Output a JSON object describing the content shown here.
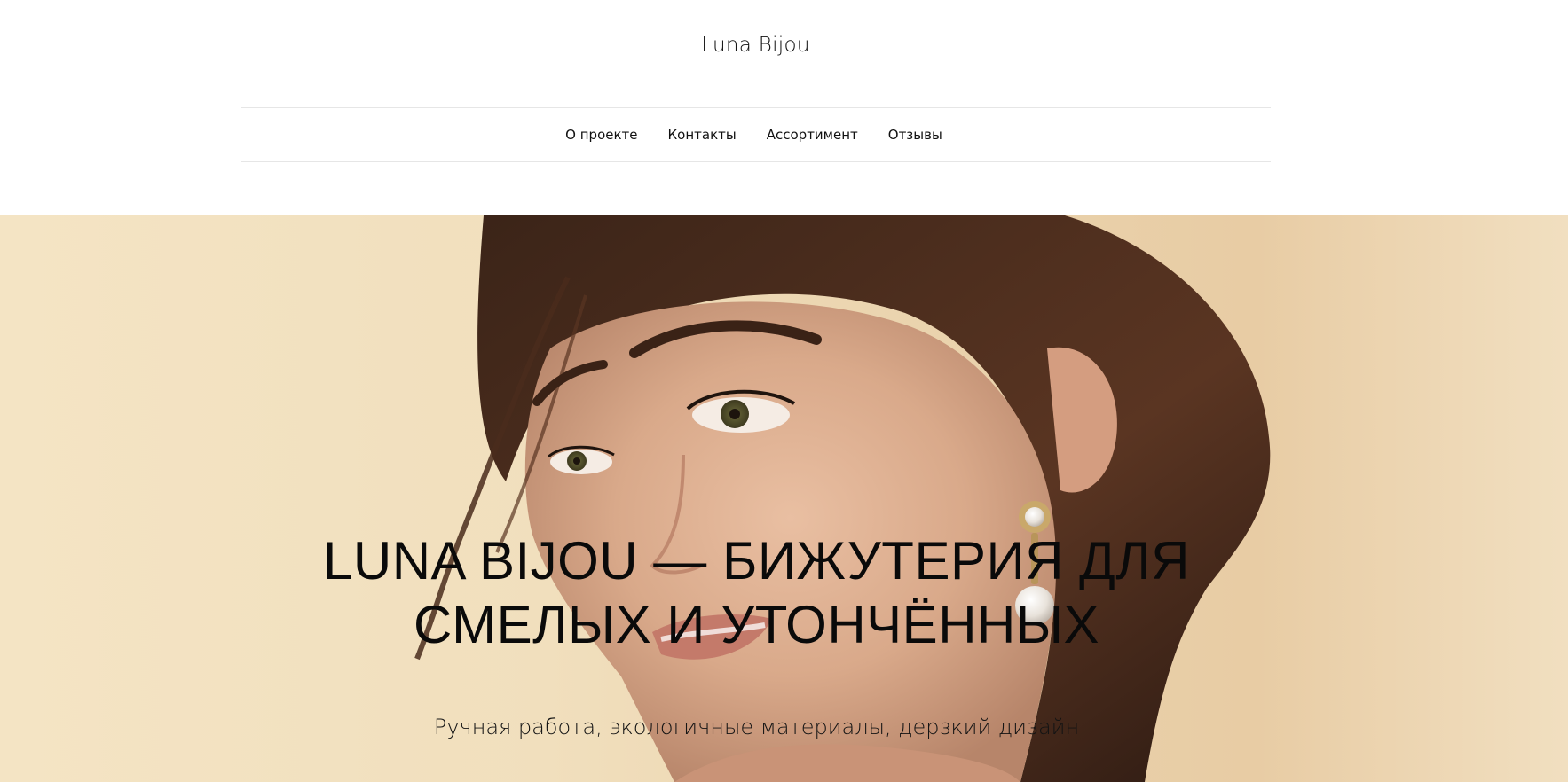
{
  "header": {
    "logo": "Luna Bijou",
    "nav": [
      {
        "label": "О проекте"
      },
      {
        "label": "Контакты"
      },
      {
        "label": "Ассортимент"
      },
      {
        "label": "Отзывы"
      }
    ]
  },
  "hero": {
    "title_line1": "LUNA BIJOU — БИЖУТЕРИЯ ДЛЯ",
    "title_line2": "СМЕЛЫХ И УТОНЧЁННЫХ",
    "subtitle": "Ручная работа, экологичные материалы, дерзкий дизайн",
    "image_subject": "woman-portrait-with-pearl-earring",
    "background_color": "#f1dfbd"
  }
}
